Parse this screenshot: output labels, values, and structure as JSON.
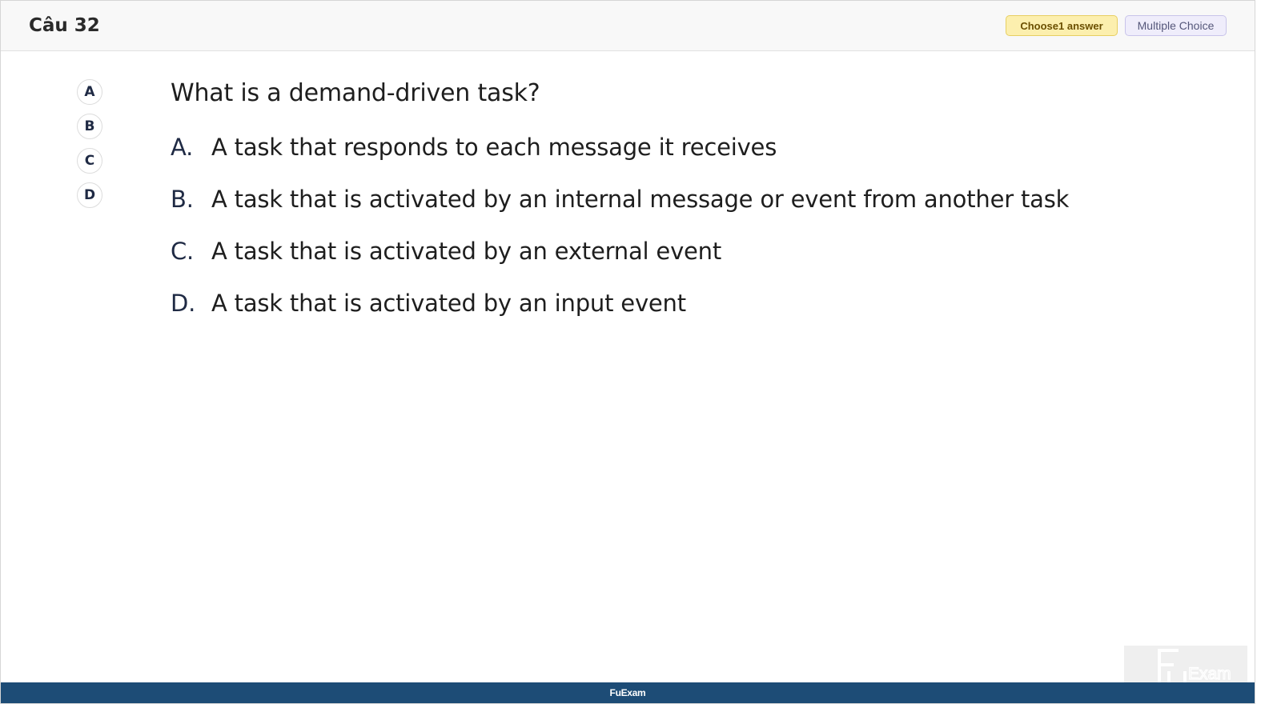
{
  "header": {
    "question_title": "Câu 32",
    "choose_badge": "Choose1 answer",
    "type_badge": "Multiple Choice"
  },
  "selector": {
    "buttons": [
      "A",
      "B",
      "C",
      "D"
    ]
  },
  "question": {
    "text": "What is a demand-driven task?",
    "options": [
      {
        "letter": "A.",
        "text": "A task that responds to each message it receives"
      },
      {
        "letter": "B.",
        "text": "A task that is activated by an internal message or event from another task"
      },
      {
        "letter": "C.",
        "text": "A task that is activated by an external event"
      },
      {
        "letter": "D.",
        "text": "A task that is activated by an input event"
      }
    ]
  },
  "footer": {
    "brand": "FuExam"
  },
  "watermark": {
    "text": "FU Exam"
  },
  "colors": {
    "footer_bg": "#1d4c76",
    "choose_badge_bg": "#fcefae",
    "type_badge_bg": "#efedfb",
    "header_bg": "#f8f8f8"
  }
}
